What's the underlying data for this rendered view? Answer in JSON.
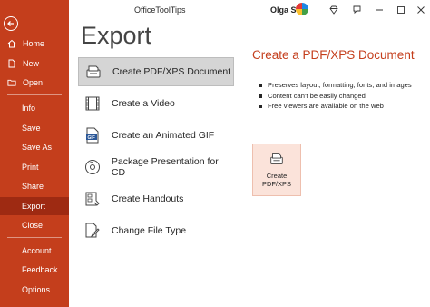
{
  "titlebar": {
    "app_title": "OfficeToolTips",
    "user_name": "Olga S"
  },
  "sidebar": {
    "items": [
      {
        "label": "Home",
        "icon": "home-icon"
      },
      {
        "label": "New",
        "icon": "new-file-icon"
      },
      {
        "label": "Open",
        "icon": "folder-icon"
      },
      {
        "label": "Info"
      },
      {
        "label": "Save"
      },
      {
        "label": "Save As"
      },
      {
        "label": "Print"
      },
      {
        "label": "Share"
      },
      {
        "label": "Export",
        "active": true
      },
      {
        "label": "Close"
      },
      {
        "label": "Account"
      },
      {
        "label": "Feedback"
      },
      {
        "label": "Options"
      }
    ]
  },
  "main": {
    "title": "Export",
    "options": [
      {
        "label": "Create PDF/XPS Document",
        "icon": "pdf-document-icon",
        "selected": true
      },
      {
        "label": "Create a Video",
        "icon": "video-film-icon"
      },
      {
        "label": "Create an Animated GIF",
        "icon": "gif-icon"
      },
      {
        "label": "Package Presentation for CD",
        "icon": "cd-icon"
      },
      {
        "label": "Create Handouts",
        "icon": "handouts-icon"
      },
      {
        "label": "Change File Type",
        "icon": "change-file-type-icon"
      }
    ]
  },
  "panel": {
    "title": "Create a PDF/XPS Document",
    "bullets": [
      "Preserves layout, formatting, fonts, and images",
      "Content can't be easily changed",
      "Free viewers are available on the web"
    ],
    "button_line1": "Create",
    "button_line2": "PDF/XPS"
  },
  "colors": {
    "sidebar_bg": "#c43e1c",
    "sidebar_active": "#9e2a12",
    "accent_text": "#c43e1c",
    "button_bg": "#fbe3da"
  }
}
